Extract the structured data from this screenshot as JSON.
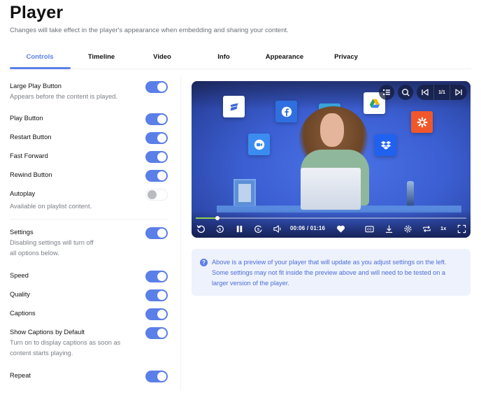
{
  "header": {
    "title": "Player",
    "subtitle": "Changes will take effect in the player's appearance when embedding and sharing your content."
  },
  "tabs": [
    {
      "label": "Controls",
      "active": true
    },
    {
      "label": "Timeline",
      "active": false
    },
    {
      "label": "Video",
      "active": false
    },
    {
      "label": "Info",
      "active": false
    },
    {
      "label": "Appearance",
      "active": false
    },
    {
      "label": "Privacy",
      "active": false
    }
  ],
  "settings": [
    {
      "label": "Large Play Button",
      "description": "Appears before the content is played.",
      "enabled": true
    },
    {
      "label": "Play Button",
      "enabled": true
    },
    {
      "label": "Restart Button",
      "enabled": true
    },
    {
      "label": "Fast Forward",
      "enabled": true
    },
    {
      "label": "Rewind Button",
      "enabled": true
    },
    {
      "label": "Autoplay",
      "description": "Available on playlist content.",
      "enabled": false
    },
    {
      "label": "Settings",
      "description_line1": "Disabling settings will turn off",
      "description_line2": "all options below.",
      "enabled": true
    },
    {
      "label": "Speed",
      "enabled": true
    },
    {
      "label": "Quality",
      "enabled": true
    },
    {
      "label": "Captions",
      "enabled": true
    },
    {
      "label": "Show Captions by Default",
      "description_line1": "Turn on to display captions as soon as",
      "description_line2": "content starts playing.",
      "enabled": true
    },
    {
      "label": "Repeat",
      "enabled": true
    }
  ],
  "player": {
    "playlist_position": "1/1",
    "current_time": "00:06",
    "duration": "01:16",
    "time_display": "00:06 / 01:16",
    "speed": "1x",
    "progress_fraction": 0.079,
    "app_icons": [
      "wix-icon",
      "facebook-icon",
      "vimeo-icon",
      "google-drive-icon",
      "zapier-icon",
      "zoom-icon",
      "dropbox-icon"
    ],
    "controls": [
      "restart-icon",
      "rewind-5-icon",
      "pause-icon",
      "forward-5-icon",
      "volume-icon",
      "heart-icon",
      "captions-icon",
      "download-icon",
      "settings-gear-icon",
      "repeat-icon",
      "fullscreen-icon"
    ]
  },
  "info": {
    "text": "Above is a preview of your player that will update as you adjust settings on the left. Some settings may not fit inside the preview above and will need to be tested on a larger version of the player."
  },
  "colors": {
    "accent": "#5b7fe8",
    "toggle_off_knob": "#b9bbbf",
    "info_bg": "#eef2fc",
    "progress": "#8fd14f"
  }
}
